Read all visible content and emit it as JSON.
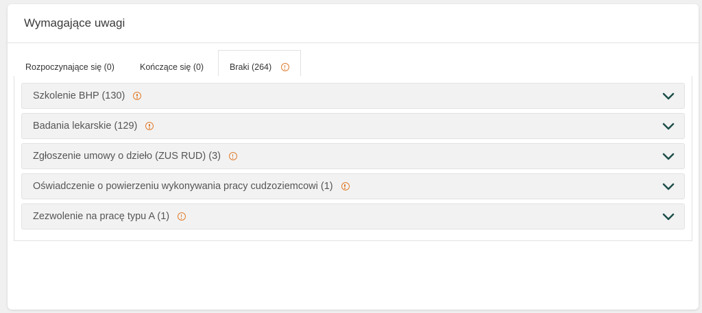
{
  "card": {
    "title": "Wymagające uwagi"
  },
  "tabs": [
    {
      "label": "Rozpoczynające się (0)",
      "warning": false
    },
    {
      "label": "Kończące się (0)",
      "warning": false
    },
    {
      "label": "Braki (264)",
      "warning": true,
      "active": true
    }
  ],
  "accordion": [
    {
      "label": "Szkolenie BHP (130)"
    },
    {
      "label": "Badania lekarskie (129)"
    },
    {
      "label": "Zgłoszenie umowy o dzieło (ZUS RUD) (3)"
    },
    {
      "label": "Oświadczenie o powierzeniu wykonywania pracy cudzoziemcowi (1)"
    },
    {
      "label": "Zezwolenie na pracę typu A (1)"
    }
  ],
  "icons": {
    "warning": "warning-circle-icon",
    "expand": "chevron-down-icon"
  },
  "colors": {
    "warning": "#e07b2a",
    "chevron": "#1f4f4a"
  }
}
